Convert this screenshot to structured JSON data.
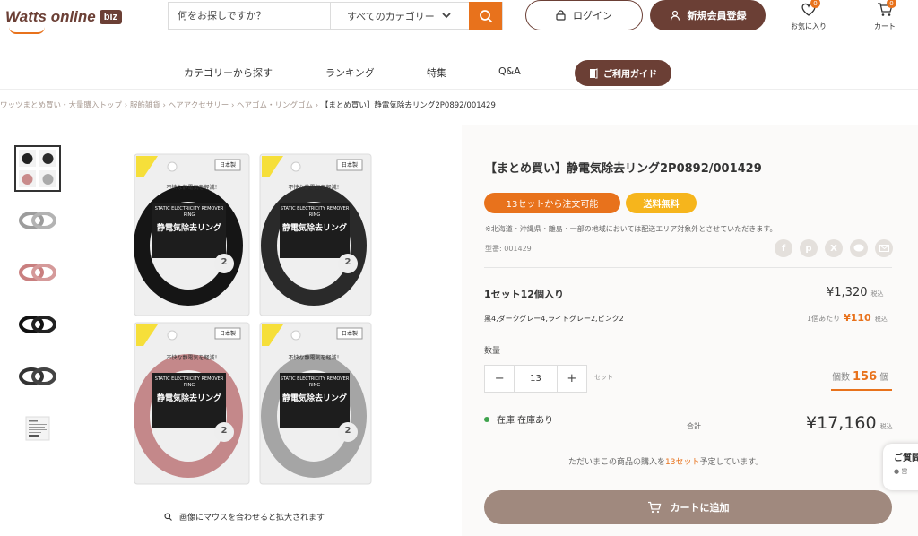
{
  "header": {
    "logo_text": "Watts online",
    "logo_biz": "biz",
    "search_placeholder": "何をお探しですか？",
    "category_select": "すべてのカテゴリー",
    "login_label": "ログイン",
    "register_label": "新規会員登録",
    "favorites_label": "お気に入り",
    "favorites_count": "0",
    "cart_label": "カート",
    "cart_count": "0"
  },
  "nav": {
    "items": [
      "カテゴリーから探す",
      "ランキング",
      "特集",
      "Q&A"
    ],
    "guide_label": "ご利用ガイド"
  },
  "breadcrumb": {
    "items": [
      "ワッツまとめ買い・大量購入トップ",
      "服飾雑貨",
      "ヘアアクセサリー",
      "ヘアゴム・リングゴム"
    ],
    "current": "【まとめ買い】静電気除去リング2P0892/001429"
  },
  "gallery": {
    "zoom_hint": "画像にマウスを合わせると拡大されます",
    "package_text": {
      "en": "STATIC ELECTRICITY REMOVER RING",
      "jp": "静電気除去リング",
      "top": "不快な静電気を軽減！",
      "made": "日本製",
      "count": "2"
    }
  },
  "product": {
    "title": "【まとめ買い】静電気除去リング2P0892/001429",
    "tag_min_order": "13セットから注文可能",
    "tag_free_shipping": "送料無料",
    "shipping_notice": "※北海道・沖縄県・離島・一部の地域においては配送エリア対象外とさせていただきます。",
    "sku_label": "型番: 001429",
    "set_label": "1セット12個入り",
    "set_price": "¥1,320",
    "tax_label": "税込",
    "colors": "黒4,ダークグレー4,ライトグレー2,ピンク2",
    "unit_price_label": "1個あたり",
    "unit_price": "¥110",
    "qty_label": "数量",
    "qty_minus": "−",
    "qty_value": "13",
    "qty_plus": "+",
    "qty_unit": "セット",
    "count_label": "個数",
    "count_value": "156",
    "count_unit": "個",
    "stock_label": "在庫 在庫あり",
    "total_label": "合計",
    "total_price": "¥17,160",
    "purchase_msg_pre": "ただいまこの商品の購入を",
    "purchase_msg_hl": "13セット",
    "purchase_msg_post": "予定しています。",
    "add_cart_label": "カートに追加"
  },
  "chat": {
    "title": "ご質問",
    "sub": "● 営"
  },
  "colors": {
    "brand_brown": "#6b3f35",
    "accent_orange": "#e8721c",
    "tag_yellow": "#f6b51c",
    "cart_button": "#a0897e"
  }
}
